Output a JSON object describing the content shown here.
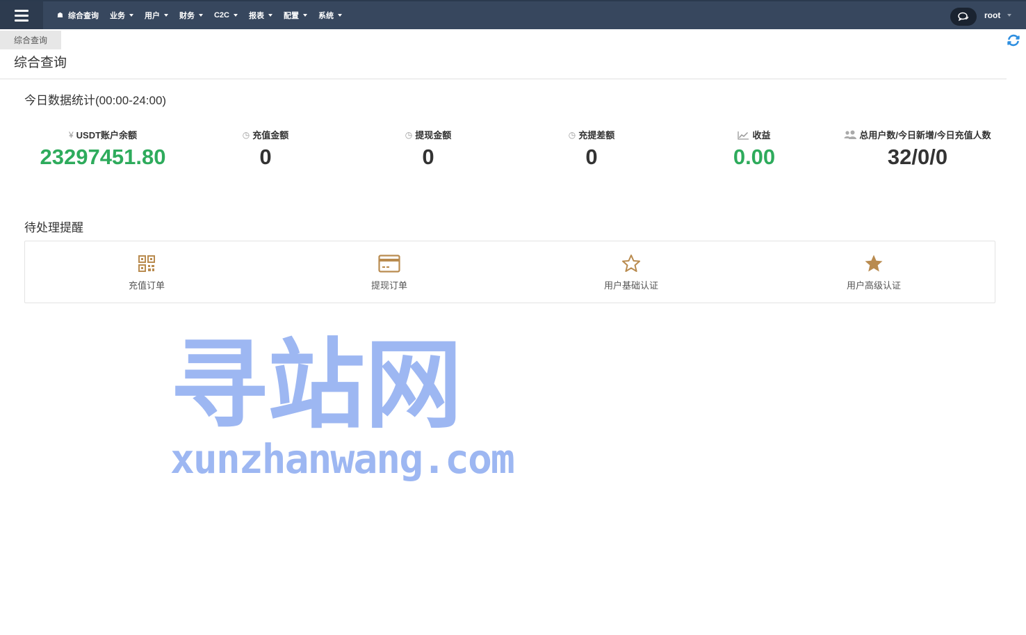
{
  "navbar": {
    "items": [
      {
        "label": "综合查询",
        "icon": "home-icon",
        "has_caret": false
      },
      {
        "label": "业务",
        "has_caret": true
      },
      {
        "label": "用户",
        "has_caret": true
      },
      {
        "label": "财务",
        "has_caret": true
      },
      {
        "label": "C2C",
        "has_caret": true
      },
      {
        "label": "报表",
        "has_caret": true
      },
      {
        "label": "配置",
        "has_caret": true
      },
      {
        "label": "系统",
        "has_caret": true
      }
    ],
    "user": "root"
  },
  "tab": {
    "label": "综合查询"
  },
  "page": {
    "title": "综合查询"
  },
  "today_stats": {
    "title": "今日数据统计(00:00-24:00)",
    "items": [
      {
        "icon": "yen-icon",
        "label": "USDT账户余额",
        "value": "23297451.80",
        "color": "#2eab5c"
      },
      {
        "icon": "clock-icon",
        "label": "充值金额",
        "value": "0",
        "color": "#333333"
      },
      {
        "icon": "clock-icon",
        "label": "提现金额",
        "value": "0",
        "color": "#333333"
      },
      {
        "icon": "clock-icon",
        "label": "充提差额",
        "value": "0",
        "color": "#333333"
      },
      {
        "icon": "chart-line-icon",
        "label": "收益",
        "value": "0.00",
        "color": "#2eab5c"
      },
      {
        "icon": "users-icon",
        "label": "总用户数/今日新增/今日充值人数",
        "value": "32/0/0",
        "color": "#333333"
      }
    ]
  },
  "pending": {
    "title": "待处理提醒",
    "items": [
      {
        "icon": "qrcode-icon",
        "label": "充值订单"
      },
      {
        "icon": "credit-card-icon",
        "label": "提现订单"
      },
      {
        "icon": "star-outline-icon",
        "label": "用户基础认证"
      },
      {
        "icon": "star-filled-icon",
        "label": "用户高级认证"
      }
    ],
    "icon_color": "#b98b4f"
  },
  "watermark": {
    "cn": "寻站网",
    "en": "xunzhanwang.com"
  }
}
